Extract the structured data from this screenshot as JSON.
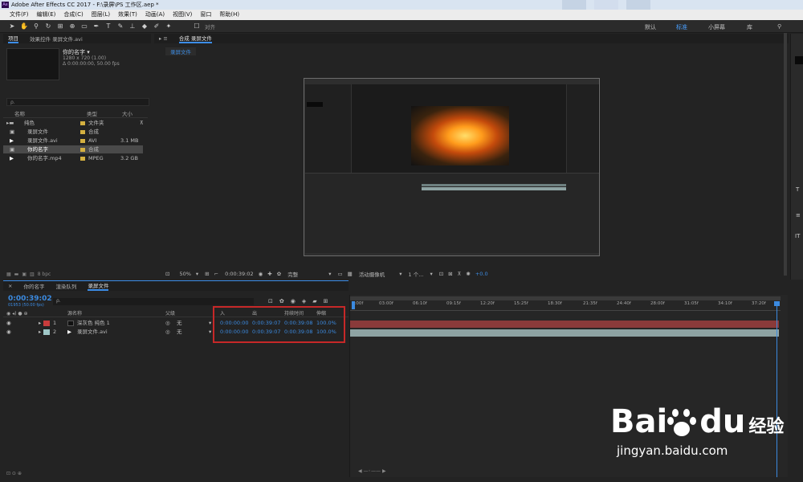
{
  "window": {
    "title": "Adobe After Effects CC 2017 - F:\\录屏\\PS 工作区.aep *",
    "logo": "Ae"
  },
  "menu": [
    "文件(F)",
    "编辑(E)",
    "合成(C)",
    "图层(L)",
    "效果(T)",
    "动画(A)",
    "视图(V)",
    "窗口",
    "帮助(H)"
  ],
  "toolbar": {
    "align_label": "对齐",
    "workspaces": [
      {
        "label": "默认",
        "active": false
      },
      {
        "label": "标准",
        "active": true
      },
      {
        "label": "小屏幕",
        "active": false
      },
      {
        "label": "库",
        "active": false
      }
    ]
  },
  "project": {
    "tabs": [
      "项目",
      "效果控件 录屏文件.avi"
    ],
    "selected_name": "你的名字 ▾",
    "selected_info1": "1280 x 720 (1.00)",
    "selected_info2": "Δ 0:00:00:00, 50.00 fps",
    "search_placeholder": "ρ.",
    "columns": [
      "名称",
      "类型",
      "大小"
    ],
    "items": [
      {
        "name": "纯色",
        "type": "文件夹",
        "size": "",
        "color": "#d4b040"
      },
      {
        "name": "录屏文件",
        "type": "合成",
        "size": "",
        "color": "#d4b040"
      },
      {
        "name": "录屏文件.avi",
        "type": "AVI",
        "size": "3.1 MB",
        "color": "#d4b040"
      },
      {
        "name": "你的名字",
        "type": "合成",
        "size": "",
        "color": "#d4b040"
      },
      {
        "name": "你的名字.mp4",
        "type": "MPEG",
        "size": "3.2 GB",
        "color": "#d4b040"
      }
    ],
    "bpc": "8 bpc"
  },
  "composition": {
    "tab_label": "合成 录屏文件",
    "sub_tab": "录屏文件",
    "zoom": "50%",
    "timecode": "0:00:39:02",
    "quality": "完整",
    "camera": "活动摄像机",
    "views": "1 个...",
    "exposure": "+0.0"
  },
  "timeline": {
    "tabs": [
      "你的名字",
      "渲染队列",
      "录屏文件"
    ],
    "current_time": "0:00:39:02",
    "fps_info": "01953 (50.00 fps)",
    "columns": {
      "source": "源名称",
      "parent": "父级",
      "in": "入",
      "out": "出",
      "duration": "持续时间",
      "stretch": "伸缩"
    },
    "layers": [
      {
        "num": "1",
        "name": "深灰色 纯色 1",
        "color": "#c83c3c",
        "parent": "无",
        "in": "0:00:00:00",
        "out": "0:00:39:07",
        "duration": "0:00:39:08",
        "stretch": "100.0%",
        "bar": "#8a3a3a"
      },
      {
        "num": "2",
        "name": "录屏文件.avi",
        "color": "#9fc7c7",
        "parent": "无",
        "in": "0:00:00:00",
        "out": "0:00:39:07",
        "duration": "0:00:39:08",
        "stretch": "100.0%",
        "bar": "#8ea3a3"
      }
    ],
    "ruler": [
      "0:00f",
      "03:00f",
      "06:10f",
      "09:15f",
      "12:20f",
      "15:25f",
      "18:30f",
      "21:35f",
      "24:40f",
      "28:00f",
      "31:05f",
      "34:10f",
      "37:20f"
    ]
  },
  "watermark": {
    "brand_left": "Bai",
    "brand_right": "du",
    "brand_cn": "经验",
    "url": "jingyan.baidu.com"
  },
  "colors": {
    "accent": "#3b8ae0",
    "highlight_box": "#c62828"
  }
}
